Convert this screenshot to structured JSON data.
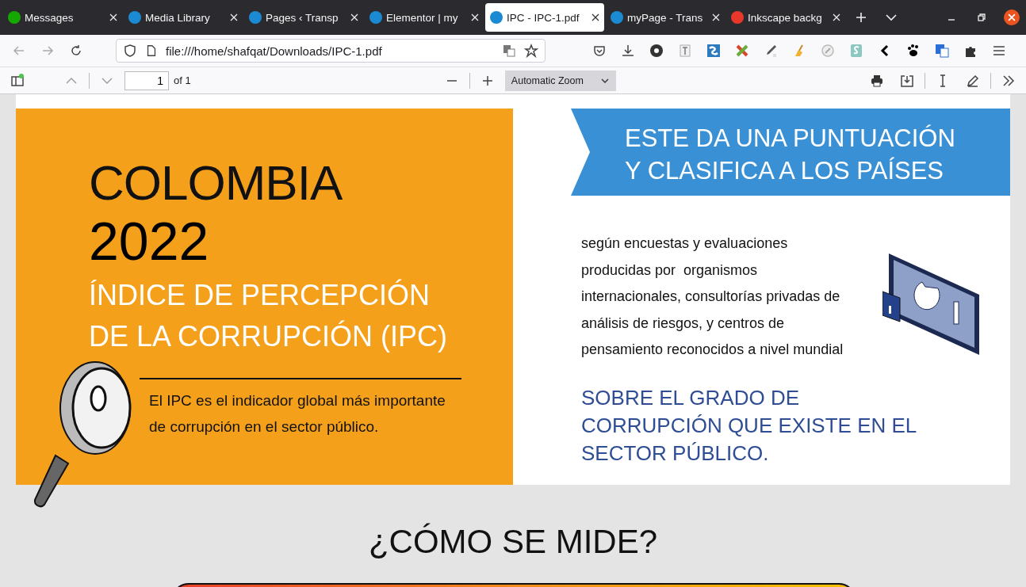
{
  "tabs": [
    {
      "label": "Messages",
      "selected": false,
      "color": "#14a800"
    },
    {
      "label": "Media Library",
      "selected": false,
      "color": "#1b8ad3"
    },
    {
      "label": "Pages ‹ Transp",
      "selected": false,
      "color": "#1b8ad3"
    },
    {
      "label": "Elementor | my",
      "selected": false,
      "color": "#1b8ad3"
    },
    {
      "label": "IPC - IPC-1.pdf",
      "selected": true,
      "color": "#1b8ad3"
    },
    {
      "label": "myPage - Trans",
      "selected": false,
      "color": "#1b8ad3"
    },
    {
      "label": "Inkscape backg",
      "selected": false,
      "color": "#e8382c"
    }
  ],
  "address": {
    "url": "file:///home/shafqat/Downloads/IPC-1.pdf"
  },
  "pdf_toolbar": {
    "page": "1",
    "page_count": "of 1",
    "zoom": "Automatic Zoom"
  },
  "document": {
    "country": "COLOMBIA",
    "year": "2022",
    "index_title": [
      "ÍNDICE DE PERCEPCIÓN",
      "DE LA CORRUPCIÓN (IPC)"
    ],
    "caption": [
      "El IPC es el indicador global más importante",
      "de corrupción en el sector público."
    ],
    "banner": [
      "ESTE DA UNA PUNTUACIÓN",
      "Y CLASIFICA A LOS PAÍSES"
    ],
    "body": [
      "según encuestas y evaluaciones",
      "producidas por  organismos",
      "internacionales, consultorías privadas de",
      "análisis de riesgos, y centros de",
      "pensamiento reconocidos a nivel mundial"
    ],
    "highlight": [
      "SOBRE EL GRADO DE",
      "CORRUPCIÓN QUE EXISTE EN EL",
      "SECTOR PÚBLICO."
    ],
    "section_title": "¿CÓMO SE MIDE?"
  }
}
